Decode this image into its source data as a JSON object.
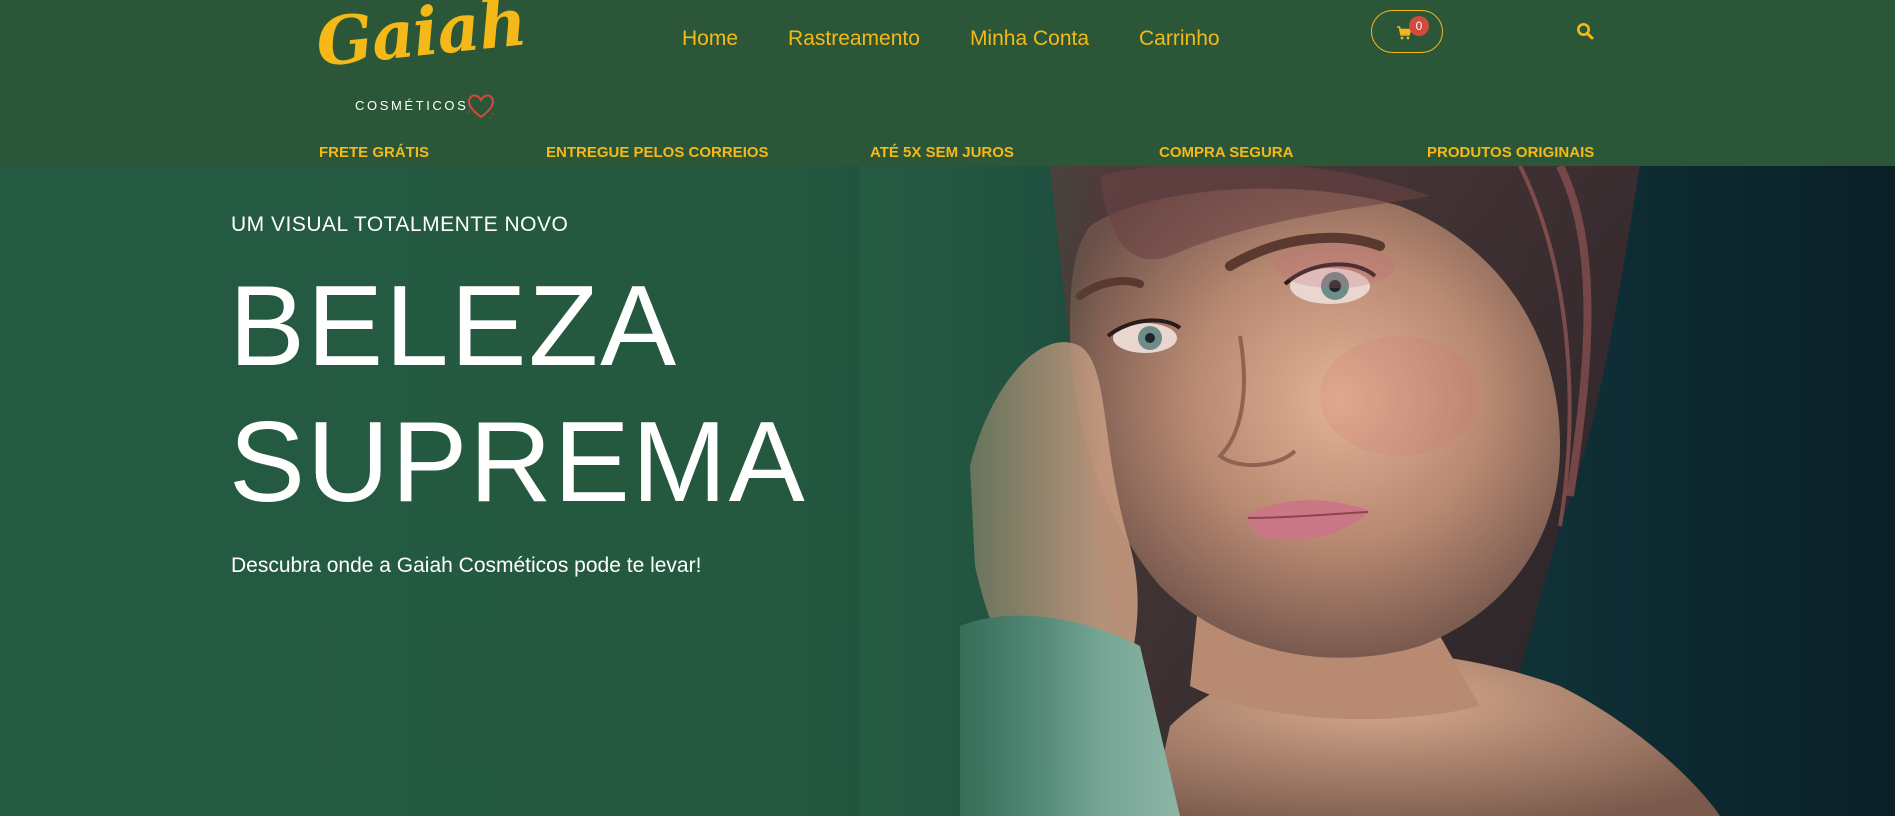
{
  "header": {
    "logo": {
      "script": "Gaiah",
      "subtitle": "COSMÉTICOS"
    },
    "nav": [
      "Home",
      "Rastreamento",
      "Minha Conta",
      "Carrinho"
    ],
    "cart": {
      "count": "0",
      "icon": "cart-icon"
    },
    "search": {
      "icon": "search-icon"
    },
    "features": [
      "FRETE GRÁTIS",
      "ENTREGUE PELOS CORREIOS",
      "ATÉ 5X SEM JUROS",
      "COMPRA SEGURA",
      "PRODUTOS ORIGINAIS"
    ]
  },
  "hero": {
    "eyebrow": "UM VISUAL TOTALMENTE NOVO",
    "headline_line1": "BELEZA",
    "headline_line2": "SUPREMA",
    "subtitle": "Descubra onde a Gaiah Cosméticos pode te levar!"
  },
  "colors": {
    "header_bg": "#2b5738",
    "accent": "#f4b918",
    "badge": "#d24a3c",
    "text": "#ffffff"
  }
}
